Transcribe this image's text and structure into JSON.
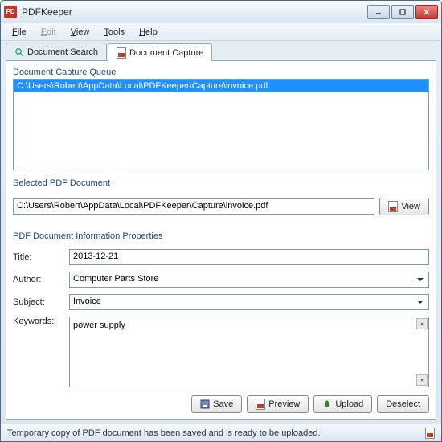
{
  "window": {
    "title": "PDFKeeper",
    "app_icon_text": "PD"
  },
  "menu": {
    "file": "File",
    "edit": "Edit",
    "view": "View",
    "tools": "Tools",
    "help": "Help"
  },
  "tabs": {
    "search": "Document Search",
    "capture": "Document Capture"
  },
  "queue": {
    "label": "Document Capture Queue",
    "items": [
      "C:\\Users\\Robert\\AppData\\Local\\PDFKeeper\\Capture\\invoice.pdf"
    ]
  },
  "selected": {
    "label": "Selected PDF Document",
    "path": "C:\\Users\\Robert\\AppData\\Local\\PDFKeeper\\Capture\\invoice.pdf",
    "view_btn": "View"
  },
  "props": {
    "label": "PDF Document Information Properties",
    "title_label": "Title:",
    "title_value": "2013-12-21",
    "author_label": "Author:",
    "author_value": "Computer Parts Store",
    "subject_label": "Subject:",
    "subject_value": "Invoice",
    "keywords_label": "Keywords:",
    "keywords_value": "power supply"
  },
  "buttons": {
    "save": "Save",
    "preview": "Preview",
    "upload": "Upload",
    "deselect": "Deselect"
  },
  "status": "Temporary copy of PDF document has been saved and is ready to be uploaded."
}
